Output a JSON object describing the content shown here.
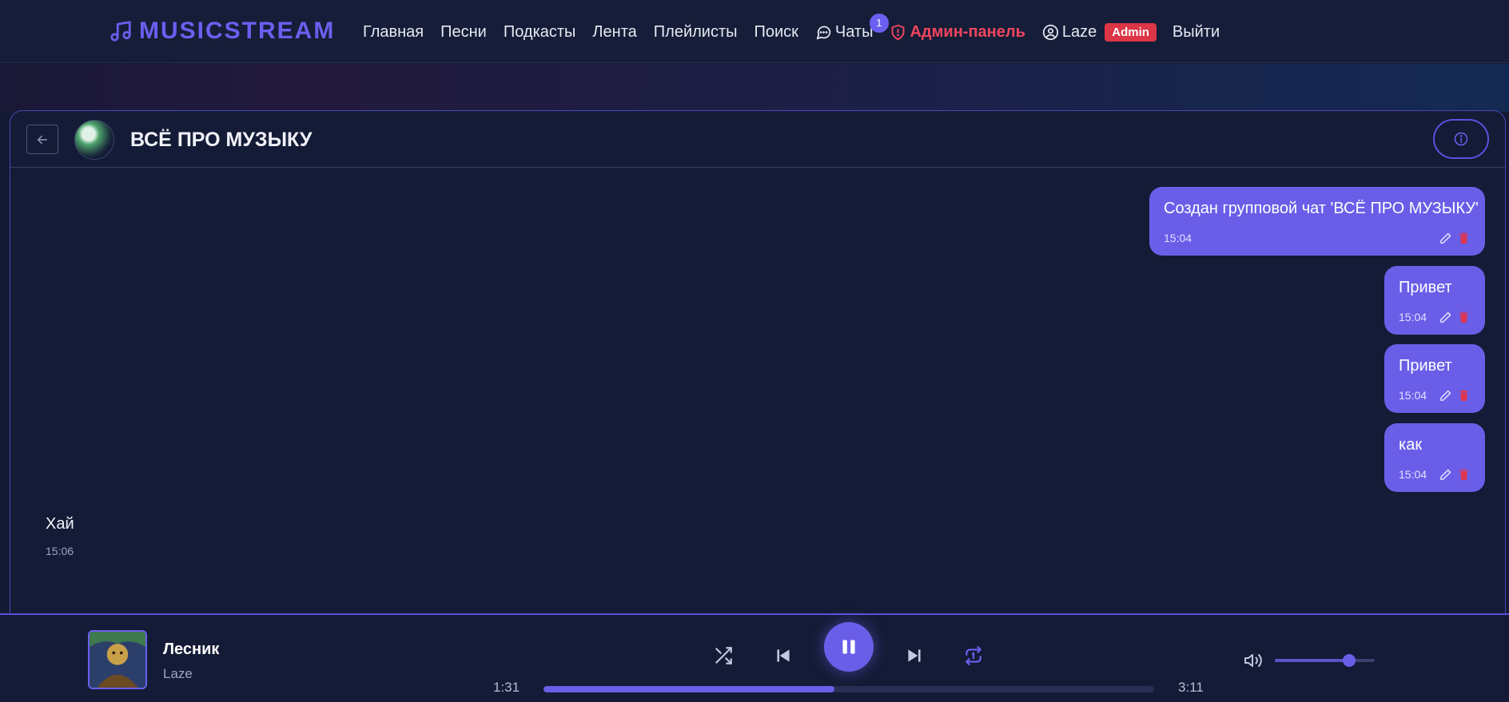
{
  "brand": {
    "name": "MUSICSTREAM",
    "icon": "music-note-icon"
  },
  "nav": {
    "home": "Главная",
    "songs": "Песни",
    "podcasts": "Подкасты",
    "feed": "Лента",
    "playlists": "Плейлисты",
    "search": "Поиск",
    "chats": "Чаты",
    "chats_badge": "1",
    "admin_panel": "Админ-панель",
    "user": "Laze",
    "role": "Admin",
    "logout": "Выйти"
  },
  "chat": {
    "title": "ВСЁ ПРО МУЗЫКУ",
    "messages": [
      {
        "text": "Создан групповой чат 'ВСЁ ПРО МУЗЫКУ'",
        "time": "15:04",
        "own": true
      },
      {
        "text": "Привет",
        "time": "15:04",
        "own": true
      },
      {
        "text": "Привет",
        "time": "15:04",
        "own": true
      },
      {
        "text": "как",
        "time": "15:04",
        "own": true
      },
      {
        "text": "Хай",
        "time": "15:06",
        "own": false
      }
    ]
  },
  "player": {
    "track_title": "Лесник",
    "artist": "Laze",
    "current_time": "1:31",
    "total_time": "3:11",
    "progress": 0.476,
    "volume": 0.74
  },
  "colors": {
    "accent": "#6a5ee8",
    "admin": "#f0455e",
    "background": "#131a33"
  }
}
